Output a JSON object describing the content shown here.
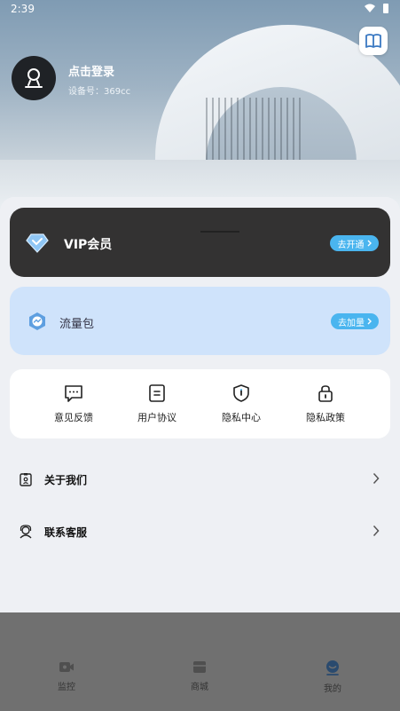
{
  "status_bar": {
    "time": "2:39"
  },
  "profile": {
    "login_text": "点击登录",
    "device_text": "设备号：369cc"
  },
  "vip": {
    "label": "VIP会员",
    "button": "去开通"
  },
  "traffic": {
    "label": "流量包",
    "button": "去加量"
  },
  "shortcuts": [
    {
      "label": "意见反馈",
      "icon": "chat-bubble-icon"
    },
    {
      "label": "用户协议",
      "icon": "document-icon"
    },
    {
      "label": "隐私中心",
      "icon": "shield-icon"
    },
    {
      "label": "隐私政策",
      "icon": "lock-icon"
    }
  ],
  "menu": [
    {
      "label": "关于我们",
      "icon": "badge-icon"
    },
    {
      "label": "联系客服",
      "icon": "headset-icon"
    }
  ],
  "tabs": [
    {
      "label": "监控",
      "icon": "camera-icon"
    },
    {
      "label": "商城",
      "icon": "store-icon"
    },
    {
      "label": "我的",
      "icon": "profile-icon"
    }
  ],
  "colors": {
    "accent": "#4ab5ef",
    "vip_card": "#333232",
    "traffic_card": "#cfe3fb",
    "overlay": "#707070"
  }
}
